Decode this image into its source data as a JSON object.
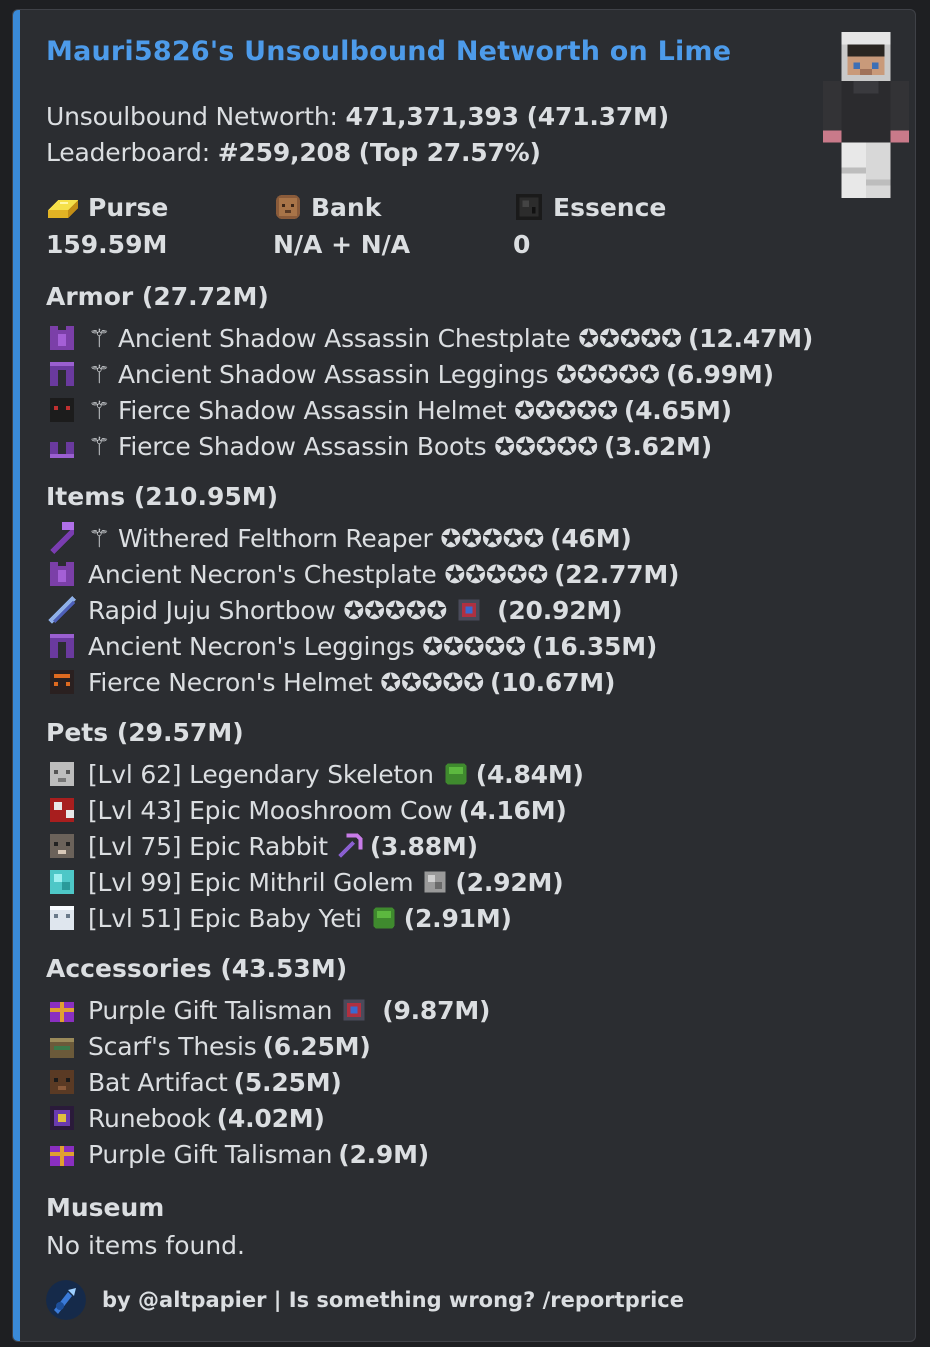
{
  "embed": {
    "title": "Mauri5826's Unsoulbound Networth on Lime",
    "networth_label": "Unsoulbound Networth: ",
    "networth_value": "471,371,393",
    "networth_short": "(471.37M)",
    "leaderboard_label": "Leaderboard: ",
    "leaderboard_rank": "#259,208",
    "leaderboard_top": "(Top 27.57%)",
    "accent_color": "#3a8ad8",
    "title_color": "#4d9bea"
  },
  "fields": [
    {
      "name": "Purse",
      "value": "159.59M",
      "icon": "gold-ingot-icon"
    },
    {
      "name": "Bank",
      "value": "N/A + N/A",
      "icon": "bank-icon"
    },
    {
      "name": "Essence",
      "value": "0",
      "icon": "wither-essence-icon"
    }
  ],
  "armor": {
    "title": "Armor (27.72M)",
    "items": [
      {
        "name": "⚚ Ancient Shadow Assassin Chestplate ✪✪✪✪✪",
        "value": "(12.47M)",
        "icon": "chestplate-icon"
      },
      {
        "name": "⚚ Ancient Shadow Assassin Leggings ✪✪✪✪✪",
        "value": "(6.99M)",
        "icon": "leggings-icon"
      },
      {
        "name": "⚚ Fierce Shadow Assassin Helmet ✪✪✪✪✪",
        "value": "(4.65M)",
        "icon": "helmet-icon"
      },
      {
        "name": "⚚ Fierce Shadow Assassin Boots ✪✪✪✪✪",
        "value": "(3.62M)",
        "icon": "boots-icon"
      }
    ]
  },
  "items": {
    "title": "Items (210.95M)",
    "items": [
      {
        "name": "⚚ Withered Felthorn Reaper ✪✪✪✪✪",
        "value": "(46M)",
        "icon": "scythe-icon"
      },
      {
        "name": "Ancient Necron's Chestplate ✪✪✪✪✪",
        "value": "(22.77M)",
        "icon": "chestplate-icon"
      },
      {
        "name": "Rapid Juju Shortbow ✪✪✪✪✪",
        "value": "(20.92M)",
        "icon": "bow-icon",
        "extra": "recombobulator-icon"
      },
      {
        "name": "Ancient Necron's Leggings ✪✪✪✪✪",
        "value": "(16.35M)",
        "icon": "leggings-icon"
      },
      {
        "name": "Fierce Necron's Helmet ✪✪✪✪✪",
        "value": "(10.67M)",
        "icon": "helmet-icon"
      }
    ]
  },
  "pets": {
    "title": "Pets (29.57M)",
    "items": [
      {
        "name": "[Lvl 62] Legendary Skeleton",
        "value": "(4.84M)",
        "icon": "skeleton-head-icon",
        "extra": "pet-item-icon"
      },
      {
        "name": "[Lvl 43] Epic Mooshroom Cow",
        "value": "(4.16M)",
        "icon": "mooshroom-head-icon"
      },
      {
        "name": "[Lvl 75] Epic Rabbit",
        "value": "(3.88M)",
        "icon": "rabbit-head-icon",
        "extra": "pickaxe-icon"
      },
      {
        "name": "[Lvl 99] Epic Mithril Golem",
        "value": "(2.92M)",
        "icon": "golem-head-icon",
        "extra": "pet-item-icon"
      },
      {
        "name": "[Lvl 51] Epic Baby Yeti",
        "value": "(2.91M)",
        "icon": "yeti-head-icon",
        "extra": "pet-item-icon"
      }
    ]
  },
  "accessories": {
    "title": "Accessories (43.53M)",
    "items": [
      {
        "name": "Purple Gift Talisman",
        "value": "(9.87M)",
        "icon": "gift-icon",
        "extra": "recombobulator-icon"
      },
      {
        "name": "Scarf's Thesis",
        "value": "(6.25M)",
        "icon": "thesis-icon"
      },
      {
        "name": "Bat Artifact",
        "value": "(5.25M)",
        "icon": "bat-icon"
      },
      {
        "name": "Runebook",
        "value": "(4.02M)",
        "icon": "runebook-icon"
      },
      {
        "name": "Purple Gift Talisman",
        "value": "(2.9M)",
        "icon": "gift-icon"
      }
    ]
  },
  "museum": {
    "title": "Museum",
    "text": "No items found."
  },
  "footer": {
    "text": "by @altpapier | Is something wrong? /reportprice",
    "icon": "bot-avatar-icon"
  }
}
